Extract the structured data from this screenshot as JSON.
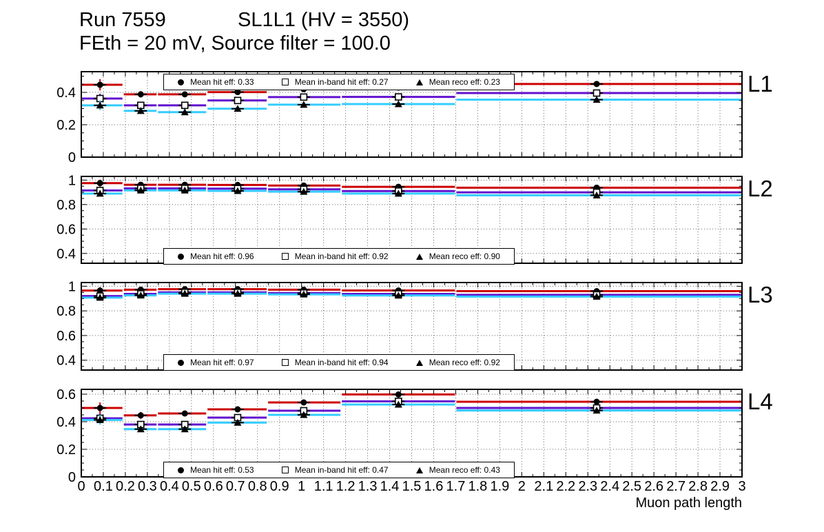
{
  "header": {
    "run": "Run 7559",
    "chamber": "SL1L1 (HV = 3550)",
    "conditions": "FEth = 20 mV, Source filter = 100.0"
  },
  "colors": {
    "hit": "#cc0000",
    "inband": "#6211cf",
    "reco": "#33ccff",
    "frame": "#000000",
    "grid": "#666666",
    "marker": "#000000"
  },
  "x_axis": {
    "title": "Muon path length",
    "min": 0,
    "max": 3,
    "tick_step": 0.1,
    "tick_labels": [
      "0",
      "0.1",
      "0.2",
      "0.3",
      "0.4",
      "0.5",
      "0.6",
      "0.7",
      "0.8",
      "0.9",
      "1",
      "1.1",
      "1.2",
      "1.3",
      "1.4",
      "1.5",
      "1.6",
      "1.7",
      "1.8",
      "1.9",
      "2",
      "2.1",
      "2.2",
      "2.3",
      "2.4",
      "2.5",
      "2.6",
      "2.7",
      "2.8",
      "2.9",
      "3"
    ]
  },
  "chart_data": [
    {
      "type": "step+scatter",
      "label": "L1",
      "ylim": [
        0,
        0.528
      ],
      "yticks": [
        {
          "v": 0,
          "label": "0"
        },
        {
          "v": 0.2,
          "label": "0.2"
        },
        {
          "v": 0.4,
          "label": "0.4"
        }
      ],
      "grid": true,
      "bin_edges": [
        0,
        0.19,
        0.345,
        0.57,
        0.845,
        1.18,
        1.7,
        3.0
      ],
      "marker_x": [
        0.085,
        0.27,
        0.47,
        0.71,
        1.01,
        1.44,
        2.34
      ],
      "legend": {
        "position": "top",
        "entries": [
          {
            "marker": "circle",
            "series": "hit",
            "label": "Mean hit  eff: 0.33"
          },
          {
            "marker": "square",
            "series": "inband",
            "label": "Mean in-band hit eff: 0.27"
          },
          {
            "marker": "triangle",
            "series": "reco",
            "label": "Mean reco eff: 0.23"
          }
        ]
      },
      "series": [
        {
          "key": "hit",
          "name": "Mean hit eff",
          "marker": "circle",
          "values": [
            0.447,
            0.388,
            0.388,
            0.402,
            0.42,
            0.43,
            0.452
          ],
          "errors": [
            0.035,
            0.02,
            0.018,
            0.015,
            0.01,
            0.012,
            0.008
          ]
        },
        {
          "key": "inband",
          "name": "Mean in-band hit eff",
          "marker": "square",
          "values": [
            0.362,
            0.32,
            0.32,
            0.35,
            0.371,
            0.372,
            0.396
          ],
          "errors": [
            0.03,
            0.018,
            0.016,
            0.014,
            0.01,
            0.01,
            0.008
          ]
        },
        {
          "key": "reco",
          "name": "Mean reco eff",
          "marker": "triangle",
          "values": [
            0.32,
            0.286,
            0.278,
            0.299,
            0.324,
            0.328,
            0.355
          ],
          "errors": [
            0.03,
            0.018,
            0.016,
            0.014,
            0.01,
            0.01,
            0.008
          ]
        }
      ]
    },
    {
      "type": "step+scatter",
      "label": "L2",
      "ylim": [
        0.32,
        1.03
      ],
      "yticks": [
        {
          "v": 0.4,
          "label": "0.4"
        },
        {
          "v": 0.6,
          "label": "0.6"
        },
        {
          "v": 0.8,
          "label": "0.8"
        },
        {
          "v": 1,
          "label": "1"
        }
      ],
      "grid": true,
      "bin_edges": [
        0,
        0.19,
        0.345,
        0.57,
        0.845,
        1.18,
        1.7,
        3.0
      ],
      "marker_x": [
        0.085,
        0.27,
        0.47,
        0.71,
        1.01,
        1.44,
        2.34
      ],
      "legend": {
        "position": "bottom",
        "entries": [
          {
            "marker": "circle",
            "series": "hit",
            "label": "Mean hit  eff: 0.96"
          },
          {
            "marker": "square",
            "series": "inband",
            "label": "Mean in-band hit eff: 0.92"
          },
          {
            "marker": "triangle",
            "series": "reco",
            "label": "Mean reco eff: 0.90"
          }
        ]
      },
      "series": [
        {
          "key": "hit",
          "name": "Mean hit eff",
          "marker": "circle",
          "values": [
            0.975,
            0.962,
            0.962,
            0.96,
            0.955,
            0.945,
            0.938
          ],
          "errors": [
            0.028,
            0.012,
            0.01,
            0.008,
            0.006,
            0.008,
            0.005
          ]
        },
        {
          "key": "inband",
          "name": "Mean in-band hit eff",
          "marker": "square",
          "values": [
            0.915,
            0.932,
            0.932,
            0.93,
            0.924,
            0.91,
            0.9
          ],
          "errors": [
            0.025,
            0.01,
            0.009,
            0.008,
            0.006,
            0.007,
            0.005
          ]
        },
        {
          "key": "reco",
          "name": "Mean reco eff",
          "marker": "triangle",
          "values": [
            0.89,
            0.916,
            0.916,
            0.912,
            0.905,
            0.89,
            0.876
          ],
          "errors": [
            0.025,
            0.01,
            0.009,
            0.008,
            0.006,
            0.007,
            0.005
          ]
        }
      ]
    },
    {
      "type": "step+scatter",
      "label": "L3",
      "ylim": [
        0.32,
        1.03
      ],
      "yticks": [
        {
          "v": 0.4,
          "label": "0.4"
        },
        {
          "v": 0.6,
          "label": "0.6"
        },
        {
          "v": 0.8,
          "label": "0.8"
        },
        {
          "v": 1,
          "label": "1"
        }
      ],
      "grid": true,
      "bin_edges": [
        0,
        0.19,
        0.345,
        0.57,
        0.845,
        1.18,
        1.7,
        3.0
      ],
      "marker_x": [
        0.085,
        0.27,
        0.47,
        0.71,
        1.01,
        1.44,
        2.34
      ],
      "legend": {
        "position": "bottom",
        "entries": [
          {
            "marker": "circle",
            "series": "hit",
            "label": "Mean hit  eff: 0.97"
          },
          {
            "marker": "square",
            "series": "inband",
            "label": "Mean in-band hit eff: 0.94"
          },
          {
            "marker": "triangle",
            "series": "reco",
            "label": "Mean reco eff: 0.92"
          }
        ]
      },
      "series": [
        {
          "key": "hit",
          "name": "Mean hit eff",
          "marker": "circle",
          "values": [
            0.965,
            0.972,
            0.976,
            0.976,
            0.972,
            0.966,
            0.96
          ],
          "errors": [
            0.028,
            0.012,
            0.01,
            0.008,
            0.006,
            0.008,
            0.005
          ]
        },
        {
          "key": "inband",
          "name": "Mean in-band hit eff",
          "marker": "square",
          "values": [
            0.92,
            0.938,
            0.95,
            0.95,
            0.945,
            0.938,
            0.93
          ],
          "errors": [
            0.025,
            0.01,
            0.009,
            0.008,
            0.006,
            0.007,
            0.005
          ]
        },
        {
          "key": "reco",
          "name": "Mean reco eff",
          "marker": "triangle",
          "values": [
            0.908,
            0.926,
            0.94,
            0.94,
            0.934,
            0.925,
            0.916
          ],
          "errors": [
            0.025,
            0.01,
            0.009,
            0.008,
            0.006,
            0.007,
            0.005
          ]
        }
      ]
    },
    {
      "type": "step+scatter",
      "label": "L4",
      "ylim": [
        0,
        0.635
      ],
      "yticks": [
        {
          "v": 0,
          "label": "0"
        },
        {
          "v": 0.2,
          "label": "0.2"
        },
        {
          "v": 0.4,
          "label": "0.4"
        },
        {
          "v": 0.6,
          "label": "0.6"
        }
      ],
      "grid": true,
      "bin_edges": [
        0,
        0.19,
        0.345,
        0.57,
        0.845,
        1.18,
        1.7,
        3.0
      ],
      "marker_x": [
        0.085,
        0.27,
        0.47,
        0.71,
        1.01,
        1.44,
        2.34
      ],
      "legend": {
        "position": "bottom",
        "entries": [
          {
            "marker": "circle",
            "series": "hit",
            "label": "Mean hit  eff: 0.53"
          },
          {
            "marker": "square",
            "series": "inband",
            "label": "Mean in-band hit eff: 0.47"
          },
          {
            "marker": "triangle",
            "series": "reco",
            "label": "Mean reco eff: 0.43"
          }
        ]
      },
      "series": [
        {
          "key": "hit",
          "name": "Mean hit eff",
          "marker": "circle",
          "values": [
            0.5,
            0.446,
            0.46,
            0.49,
            0.54,
            0.598,
            0.545
          ],
          "errors": [
            0.04,
            0.025,
            0.02,
            0.018,
            0.012,
            0.015,
            0.01
          ]
        },
        {
          "key": "inband",
          "name": "Mean in-band hit eff",
          "marker": "square",
          "values": [
            0.425,
            0.38,
            0.38,
            0.43,
            0.48,
            0.548,
            0.5
          ],
          "errors": [
            0.035,
            0.022,
            0.018,
            0.016,
            0.012,
            0.013,
            0.009
          ]
        },
        {
          "key": "reco",
          "name": "Mean reco eff",
          "marker": "triangle",
          "values": [
            0.413,
            0.346,
            0.346,
            0.394,
            0.45,
            0.525,
            0.482
          ],
          "errors": [
            0.035,
            0.022,
            0.018,
            0.016,
            0.012,
            0.013,
            0.009
          ]
        }
      ]
    }
  ]
}
